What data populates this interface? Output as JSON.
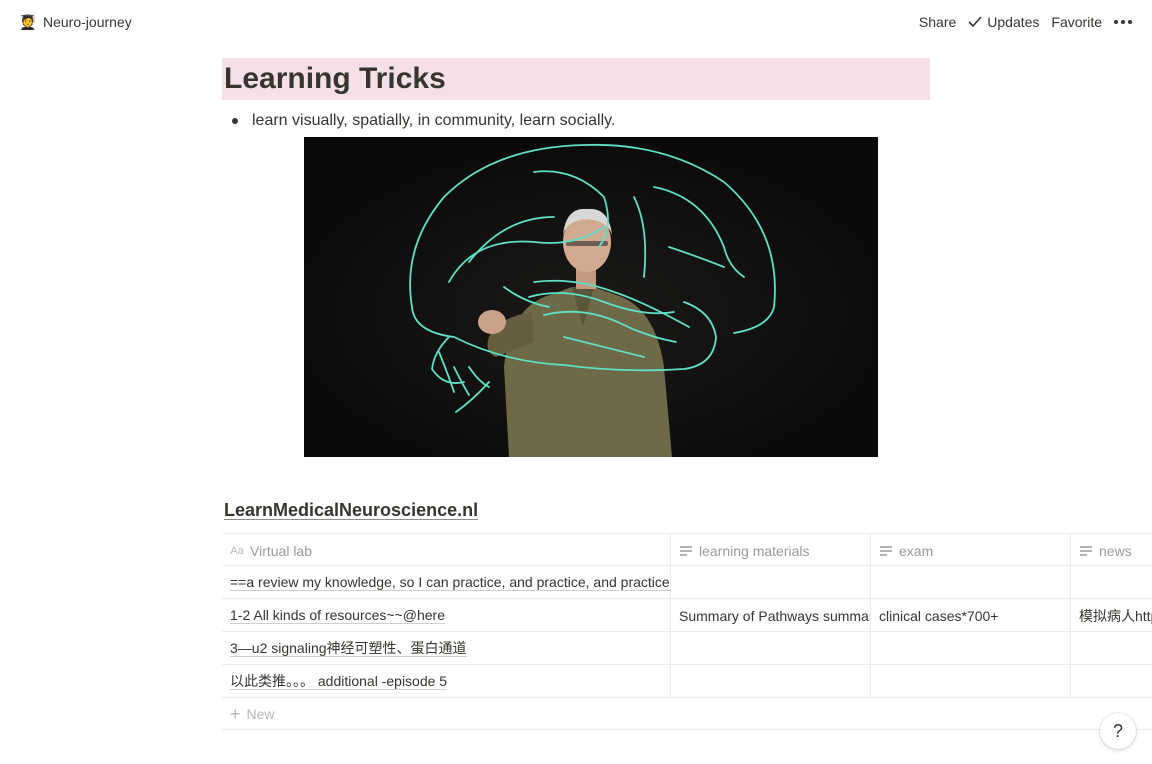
{
  "topbar": {
    "page_icon": "🧑‍🎓",
    "page_name": "Neuro-journey",
    "share": "Share",
    "updates": "Updates",
    "favorite": "Favorite"
  },
  "page": {
    "heading": "Learning Tricks",
    "heading_bg": "#f5e0e9",
    "bullet": "learn visually, spatially, in community, learn socially."
  },
  "database": {
    "title": "LearnMedicalNeuroscience.nl",
    "columns": [
      {
        "icon": "title-property-icon",
        "label": "Virtual lab"
      },
      {
        "icon": "text-property-icon",
        "label": "learning materials"
      },
      {
        "icon": "text-property-icon",
        "label": "exam"
      },
      {
        "icon": "text-property-icon",
        "label": "news"
      }
    ],
    "rows": [
      [
        "==a review my knowledge, so I can practice, and practice, and practice",
        "",
        "",
        ""
      ],
      [
        "1-2 All kinds of resources~~@here",
        "Summary of Pathways summary",
        "clinical cases*700+",
        "模拟病人http"
      ],
      [
        "3—u2 signaling神经可塑性、蛋白通道",
        "",
        "",
        ""
      ],
      [
        "以此类推。。。 additional -episode 5",
        "",
        "",
        ""
      ]
    ],
    "new_label": "New"
  },
  "help_label": "?"
}
